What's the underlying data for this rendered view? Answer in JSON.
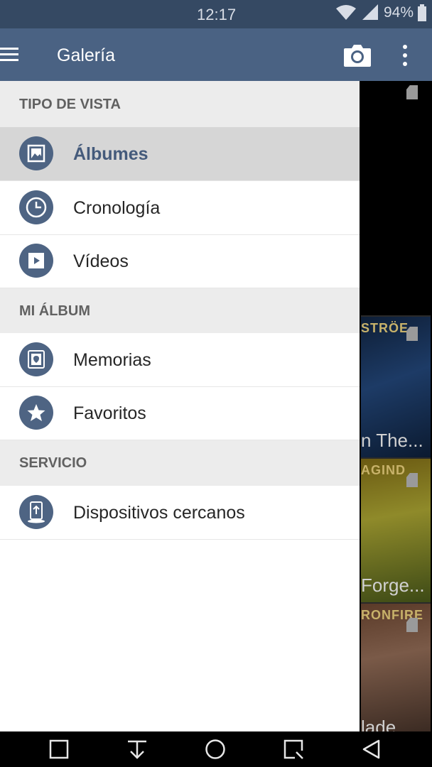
{
  "status": {
    "time": "12:17",
    "battery": "94%"
  },
  "appbar": {
    "title": "Galería",
    "menu_icon": "hamburger-icon",
    "camera_icon": "camera-icon",
    "overflow_icon": "more-vert-icon"
  },
  "drawer": {
    "sections": [
      {
        "title": "TIPO DE VISTA",
        "items": [
          {
            "label": "Álbumes",
            "icon": "album-icon",
            "selected": true
          },
          {
            "label": "Cronología",
            "icon": "clock-icon",
            "selected": false
          },
          {
            "label": "Vídeos",
            "icon": "video-icon",
            "selected": false
          }
        ]
      },
      {
        "title": "MI ÁLBUM",
        "items": [
          {
            "label": "Memorias",
            "icon": "memories-icon",
            "selected": false
          },
          {
            "label": "Favoritos",
            "icon": "star-icon",
            "selected": false
          }
        ]
      },
      {
        "title": "SERVICIO",
        "items": [
          {
            "label": "Dispositivos cercanos",
            "icon": "nearby-devices-icon",
            "selected": false
          }
        ]
      }
    ]
  },
  "gallery": {
    "thumbs": [
      {
        "band": "",
        "caption": ""
      },
      {
        "band": "STRÖE",
        "caption": "n The..."
      },
      {
        "band": "AGIND",
        "caption": "Forge..."
      },
      {
        "band": "RONFIRE",
        "caption": "lade"
      }
    ]
  },
  "colors": {
    "statusbar": "#354963",
    "appbar": "#4a6283",
    "accent": "#445a7b",
    "icon_circle": "#4e6483"
  }
}
